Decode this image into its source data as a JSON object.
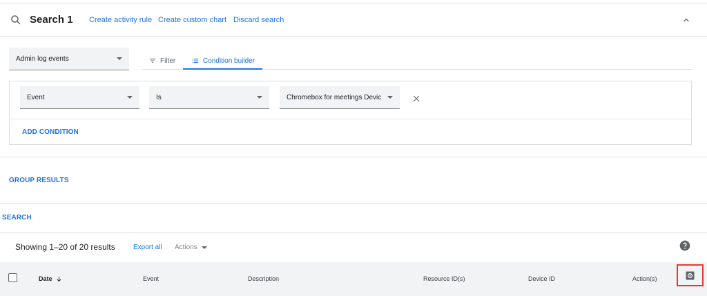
{
  "header": {
    "title": "Search 1",
    "links": [
      "Create activity rule",
      "Create custom chart",
      "Discard search"
    ]
  },
  "data_source": {
    "selected": "Admin log events"
  },
  "tabs": [
    {
      "label": "Filter",
      "icon": "filter-icon",
      "active": false
    },
    {
      "label": "Condition builder",
      "icon": "list-icon",
      "active": true
    }
  ],
  "condition": {
    "attribute": "Event",
    "operator": "Is",
    "value": "Chromebox for meetings Devic..."
  },
  "actions": {
    "add_condition": "ADD CONDITION",
    "group_results": "GROUP RESULTS",
    "search": "SEARCH"
  },
  "results": {
    "showing": "Showing 1–20 of 20 results",
    "export_all": "Export all",
    "actions_label": "Actions"
  },
  "table": {
    "columns": [
      "Date",
      "Event",
      "Description",
      "Resource ID(s)",
      "Device ID",
      "Action(s)"
    ]
  },
  "colors": {
    "accent": "#1a73e8",
    "highlight_border": "#e53935",
    "header_bg": "#f1f3f4"
  }
}
